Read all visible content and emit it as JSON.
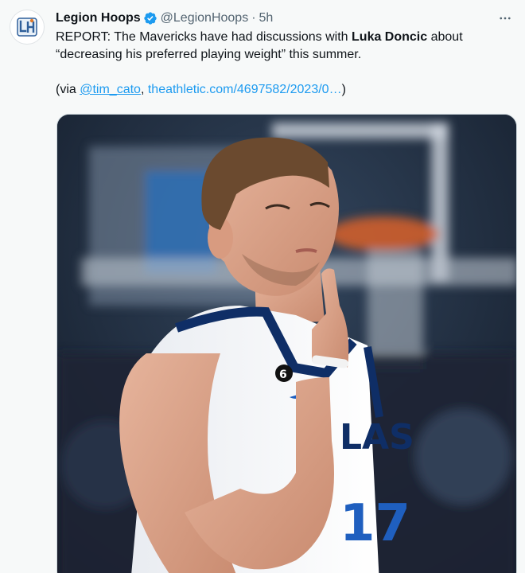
{
  "author": {
    "display_name": "Legion Hoops",
    "handle": "@LegionHoops",
    "separator": "·",
    "time": "5h",
    "avatar_icon": "legion-hoops-logo",
    "avatar_text": "LH",
    "verified_icon": "verified-badge-icon",
    "verified_color": "#1d9bf0"
  },
  "tweet": {
    "text_part1": "REPORT: The Mavericks have had discussions with ",
    "text_bold": "Luka Doncic",
    "text_part2": " about “decreasing his preferred playing weight” this summer.",
    "via_prefix": "(via ",
    "mention": "@tim_cato",
    "comma": ", ",
    "link": "theathletic.com/4697582/2023/0…",
    "via_suffix": ")"
  },
  "more_icon": "more-options-icon",
  "media": {
    "description_icon": "photo",
    "jersey_number": "17",
    "jersey_text": "LAS",
    "patch_number": "6"
  },
  "colors": {
    "link": "#1d9bf0",
    "text": "#0f1419",
    "secondary": "#536471",
    "background": "#f7f9f9"
  }
}
